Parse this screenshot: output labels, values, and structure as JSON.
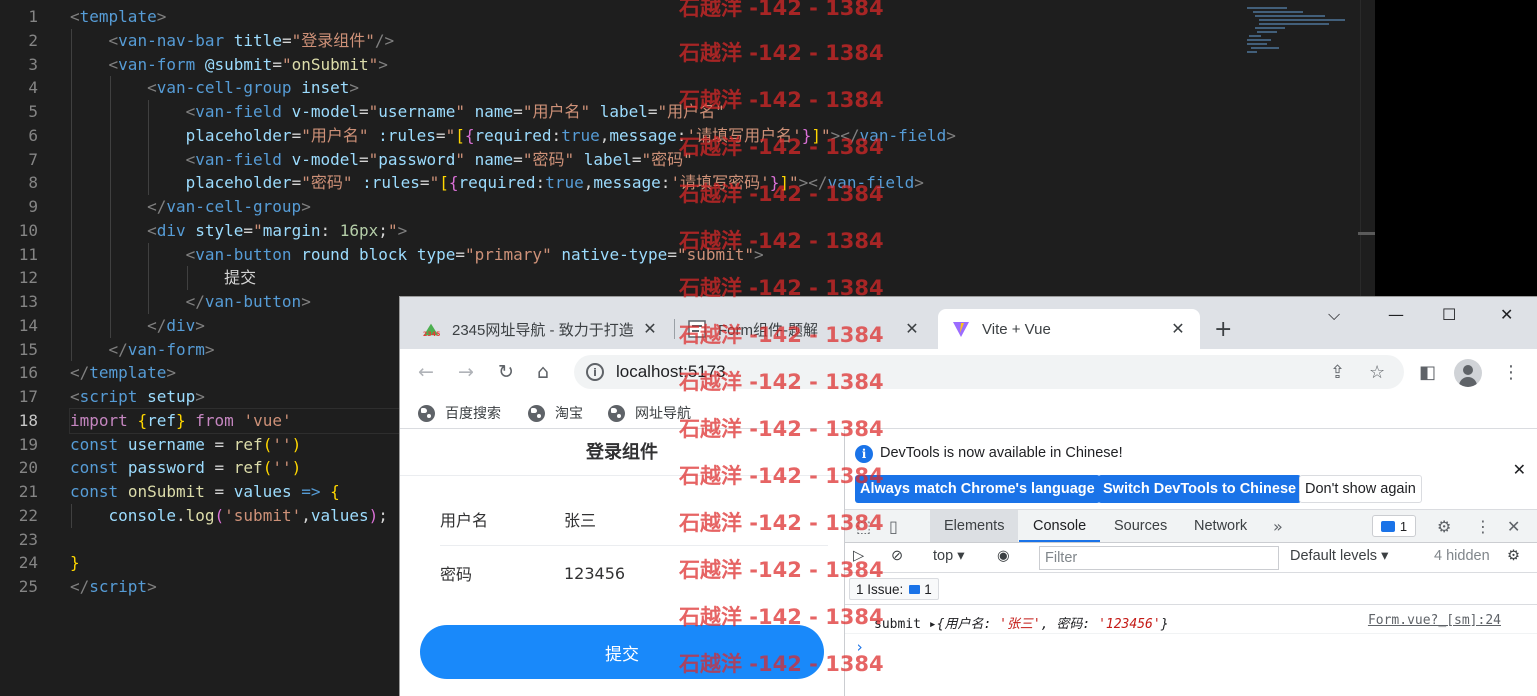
{
  "editor": {
    "line_numbers": [
      "1",
      "2",
      "3",
      "4",
      "5",
      "6",
      "7",
      "8",
      "9",
      "10",
      "11",
      "12",
      "13",
      "14",
      "15",
      "16",
      "17",
      "18",
      "19",
      "20",
      "21",
      "22",
      "23",
      "24",
      "25"
    ],
    "current_line": "18"
  },
  "browser": {
    "tabs": [
      {
        "title": "2345网址导航 - 致力于打造",
        "close": "✕"
      },
      {
        "title": "Form组件-题解",
        "close": "✕"
      },
      {
        "title": "Vite + Vue",
        "close": "✕"
      }
    ],
    "new_tab": "+",
    "url": "localhost:5173",
    "bookmarks": [
      "百度搜索",
      "淘宝",
      "网址导航"
    ]
  },
  "page": {
    "nav_title": "登录组件",
    "fields": [
      {
        "label": "用户名",
        "value": "张三"
      },
      {
        "label": "密码",
        "value": "123456"
      }
    ],
    "submit_label": "提交"
  },
  "devtools": {
    "info_message": "DevTools is now available in Chinese!",
    "buttons": {
      "match": "Always match Chrome's language",
      "switch": "Switch DevTools to Chinese",
      "dont_show": "Don't show again"
    },
    "tabs": [
      "Elements",
      "Console",
      "Sources",
      "Network"
    ],
    "active_tab": "Console",
    "issues_count": "1",
    "context": "top",
    "filter_placeholder": "Filter",
    "levels": "Default levels",
    "hidden": "4 hidden",
    "issue_chip": "1 Issue:",
    "issue_chip_count": "1",
    "log": {
      "text": "submit",
      "object_open": "{用户名: ",
      "username": "'张三'",
      "mid": ", 密码: ",
      "password": "'123456'",
      "object_close": "}",
      "source": "Form.vue?_[sm]:24"
    }
  },
  "watermark": {
    "text": "石越洋 -142 - 1384",
    "color": "#dc2828"
  },
  "colors": {
    "vant_primary": "#1989fa",
    "chrome_blue": "#1a73e8",
    "editor_bg": "#1e1e1e"
  }
}
